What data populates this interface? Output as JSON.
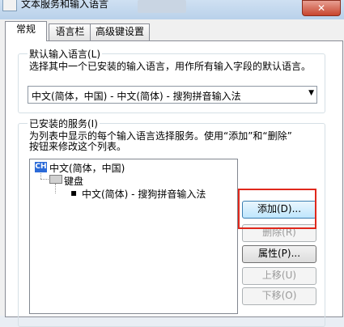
{
  "window": {
    "title": "文本服务和输入语言",
    "close_label": "✕"
  },
  "tabs": [
    {
      "label": "常规",
      "active": true
    },
    {
      "label": "语言栏",
      "active": false
    },
    {
      "label": "高级键设置",
      "active": false
    }
  ],
  "default_language": {
    "group_label": "默认输入语言(L)",
    "description": "选择其中一个已安装的输入语言，用作所有输入字段的默认语言。",
    "selected_value": "中文(简体，中国) - 中文(简体) - 搜狗拼音输入法"
  },
  "installed_services": {
    "group_label": "已安装的服务(I)",
    "description_line1": "为列表中显示的每个输入语言选择服务。使用“添加”和“删除”",
    "description_line2": "按钮来修改这个列表。",
    "tree": {
      "language_badge": "CH",
      "language": "中文(简体，中国)",
      "category": "键盘",
      "service": "中文(简体) - 搜狗拼音输入法"
    }
  },
  "buttons": {
    "add": "添加(D)...",
    "remove": "删除(R)",
    "properties": "属性(P)...",
    "move_up": "上移(U)",
    "move_down": "下移(O)"
  },
  "colors": {
    "highlight_box": "#e0281c",
    "language_badge": "#2c6bd8"
  }
}
